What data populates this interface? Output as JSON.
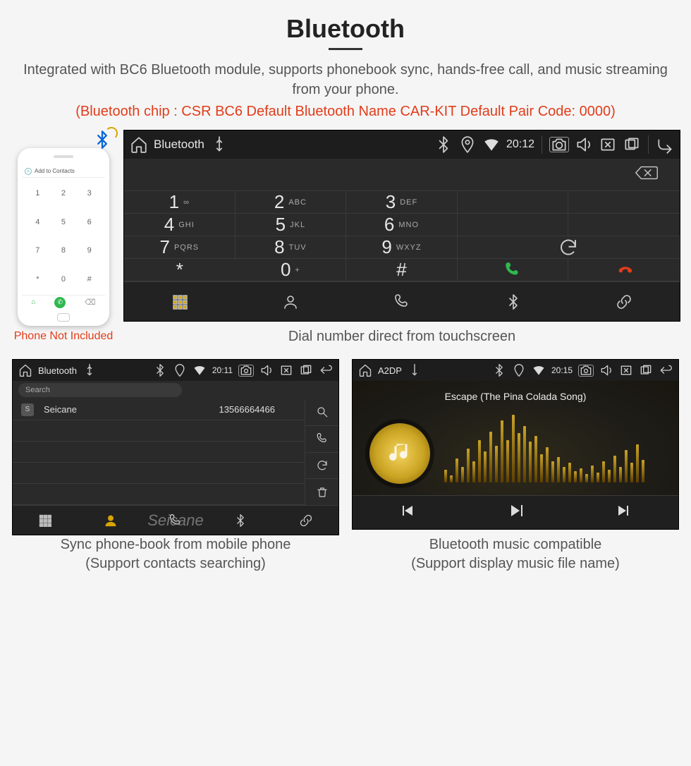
{
  "headline": "Bluetooth",
  "subheadline": "Integrated with BC6 Bluetooth module, supports phonebook sync, hands-free call, and music streaming from your phone.",
  "spec_line": "(Bluetooth chip : CSR BC6     Default Bluetooth Name CAR-KIT     Default Pair Code: 0000)",
  "phone": {
    "add_to_contacts": "Add to Contacts",
    "keys": [
      "1",
      "2",
      "3",
      "4",
      "5",
      "6",
      "7",
      "8",
      "9",
      "*",
      "0",
      "#"
    ],
    "caption": "Phone Not Included"
  },
  "dialer": {
    "status": {
      "title": "Bluetooth",
      "time": "20:12"
    },
    "keys": [
      {
        "n": "1",
        "l": "∞"
      },
      {
        "n": "2",
        "l": "ABC"
      },
      {
        "n": "3",
        "l": "DEF"
      },
      {
        "n": "4",
        "l": "GHI"
      },
      {
        "n": "5",
        "l": "JKL"
      },
      {
        "n": "6",
        "l": "MNO"
      },
      {
        "n": "7",
        "l": "PQRS"
      },
      {
        "n": "8",
        "l": "TUV"
      },
      {
        "n": "9",
        "l": "WXYZ"
      },
      {
        "n": "*",
        "l": ""
      },
      {
        "n": "0",
        "l": "+",
        "sup": true
      },
      {
        "n": "#",
        "l": ""
      }
    ],
    "caption": "Dial number direct from touchscreen"
  },
  "phonebook": {
    "status": {
      "title": "Bluetooth",
      "time": "20:11"
    },
    "search_placeholder": "Search",
    "contacts": [
      {
        "initial": "S",
        "name": "Seicane",
        "number": "13566664466"
      }
    ],
    "caption_line1": "Sync phone-book from mobile phone",
    "caption_line2": "(Support contacts searching)",
    "watermark": "Seicane"
  },
  "music": {
    "status": {
      "title": "A2DP",
      "time": "20:15"
    },
    "song": "Escape (The Pina Colada Song)",
    "caption_line1": "Bluetooth music compatible",
    "caption_line2": "(Support display music file name)"
  }
}
